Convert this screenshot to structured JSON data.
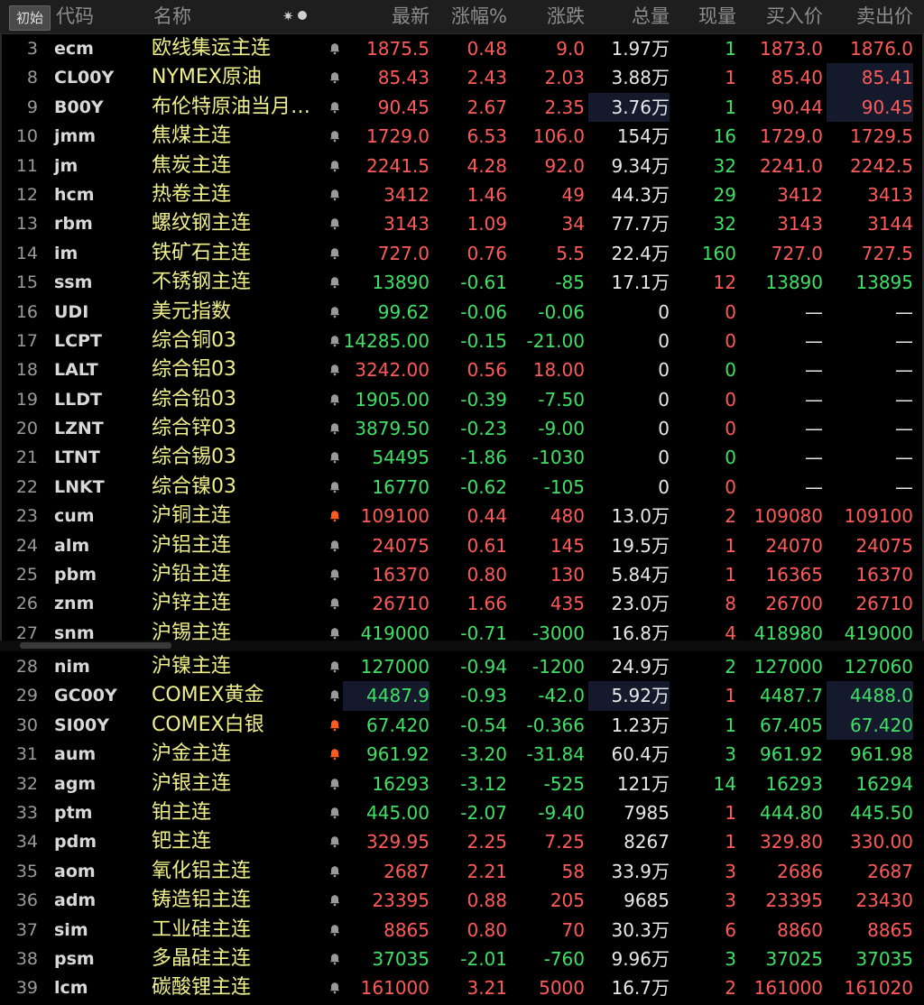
{
  "header": {
    "reset_button": "初始",
    "col_code": "代码",
    "col_name": "名称",
    "star_glyph": "✷",
    "col_last": "最新",
    "col_pct": "涨幅%",
    "col_chg": "涨跌",
    "col_vol": "总量",
    "col_cur": "现量",
    "col_bid": "买入价",
    "col_ask": "卖出价"
  },
  "colors": {
    "up": "#ff5a5a",
    "down": "#3ee066",
    "name": "#f0f08a",
    "bell_active": "#ff5a1e",
    "bell_inactive": "#9a9a9a"
  },
  "rows_top": [
    {
      "idx": "3",
      "code": "ecm",
      "name": "欧线集运主连",
      "bell": "inactive",
      "last": "1875.5",
      "pct": "0.48",
      "chg": "9.0",
      "vol": "1.97万",
      "cur": "1",
      "bid": "1873.0",
      "ask": "1876.0",
      "dir": "up",
      "cur_dir": "dn"
    },
    {
      "idx": "8",
      "code": "CL00Y",
      "name": "NYMEX原油",
      "bell": "inactive",
      "last": "85.43",
      "pct": "2.43",
      "chg": "2.03",
      "vol": "3.88万",
      "cur": "1",
      "bid": "85.40",
      "ask": "85.41",
      "dir": "up",
      "cur_dir": "up",
      "hl_ask": true
    },
    {
      "idx": "9",
      "code": "B00Y",
      "name": "布伦特原油当月…",
      "bell": "inactive",
      "last": "90.45",
      "pct": "2.67",
      "chg": "2.35",
      "vol": "3.76万",
      "cur": "1",
      "bid": "90.44",
      "ask": "90.45",
      "dir": "up",
      "cur_dir": "dn",
      "hl_vol": true,
      "hl_ask": true
    },
    {
      "idx": "10",
      "code": "jmm",
      "name": "焦煤主连",
      "bell": "inactive",
      "last": "1729.0",
      "pct": "6.53",
      "chg": "106.0",
      "vol": "154万",
      "cur": "16",
      "bid": "1729.0",
      "ask": "1729.5",
      "dir": "up",
      "cur_dir": "dn"
    },
    {
      "idx": "11",
      "code": "jm",
      "name": "焦炭主连",
      "bell": "inactive",
      "last": "2241.5",
      "pct": "4.28",
      "chg": "92.0",
      "vol": "9.34万",
      "cur": "32",
      "bid": "2241.0",
      "ask": "2242.5",
      "dir": "up",
      "cur_dir": "dn"
    },
    {
      "idx": "12",
      "code": "hcm",
      "name": "热卷主连",
      "bell": "inactive",
      "last": "3412",
      "pct": "1.46",
      "chg": "49",
      "vol": "44.3万",
      "cur": "29",
      "bid": "3412",
      "ask": "3413",
      "dir": "up",
      "cur_dir": "dn"
    },
    {
      "idx": "13",
      "code": "rbm",
      "name": "螺纹钢主连",
      "bell": "inactive",
      "last": "3143",
      "pct": "1.09",
      "chg": "34",
      "vol": "77.7万",
      "cur": "32",
      "bid": "3143",
      "ask": "3144",
      "dir": "up",
      "cur_dir": "dn"
    },
    {
      "idx": "14",
      "code": "im",
      "name": "铁矿石主连",
      "bell": "inactive",
      "last": "727.0",
      "pct": "0.76",
      "chg": "5.5",
      "vol": "22.4万",
      "cur": "160",
      "bid": "727.0",
      "ask": "727.5",
      "dir": "up",
      "cur_dir": "dn"
    },
    {
      "idx": "15",
      "code": "ssm",
      "name": "不锈钢主连",
      "bell": "inactive",
      "last": "13890",
      "pct": "-0.61",
      "chg": "-85",
      "vol": "17.1万",
      "cur": "12",
      "bid": "13890",
      "ask": "13895",
      "dir": "dn",
      "cur_dir": "up"
    },
    {
      "idx": "16",
      "code": "UDI",
      "name": "美元指数",
      "bell": "inactive",
      "last": "99.62",
      "pct": "-0.06",
      "chg": "-0.06",
      "vol": "0",
      "cur": "0",
      "bid": "—",
      "ask": "—",
      "dir": "dn",
      "cur_dir": "up"
    },
    {
      "idx": "17",
      "code": "LCPT",
      "name": "综合铜03",
      "bell": "inactive",
      "last": "14285.00",
      "pct": "-0.15",
      "chg": "-21.00",
      "vol": "0",
      "cur": "0",
      "bid": "—",
      "ask": "—",
      "dir": "dn",
      "cur_dir": "up"
    },
    {
      "idx": "18",
      "code": "LALT",
      "name": "综合铝03",
      "bell": "inactive",
      "last": "3242.00",
      "pct": "0.56",
      "chg": "18.00",
      "vol": "0",
      "cur": "0",
      "bid": "—",
      "ask": "—",
      "dir": "up",
      "cur_dir": "dn"
    },
    {
      "idx": "19",
      "code": "LLDT",
      "name": "综合铅03",
      "bell": "inactive",
      "last": "1905.00",
      "pct": "-0.39",
      "chg": "-7.50",
      "vol": "0",
      "cur": "0",
      "bid": "—",
      "ask": "—",
      "dir": "dn",
      "cur_dir": "up"
    },
    {
      "idx": "20",
      "code": "LZNT",
      "name": "综合锌03",
      "bell": "inactive",
      "last": "3879.50",
      "pct": "-0.23",
      "chg": "-9.00",
      "vol": "0",
      "cur": "0",
      "bid": "—",
      "ask": "—",
      "dir": "dn",
      "cur_dir": "up"
    },
    {
      "idx": "21",
      "code": "LTNT",
      "name": "综合锡03",
      "bell": "inactive",
      "last": "54495",
      "pct": "-1.86",
      "chg": "-1030",
      "vol": "0",
      "cur": "0",
      "bid": "—",
      "ask": "—",
      "dir": "dn",
      "cur_dir": "dn"
    },
    {
      "idx": "22",
      "code": "LNKT",
      "name": "综合镍03",
      "bell": "inactive",
      "last": "16770",
      "pct": "-0.62",
      "chg": "-105",
      "vol": "0",
      "cur": "0",
      "bid": "—",
      "ask": "—",
      "dir": "dn",
      "cur_dir": "up"
    },
    {
      "idx": "23",
      "code": "cum",
      "name": "沪铜主连",
      "bell": "active",
      "last": "109100",
      "pct": "0.44",
      "chg": "480",
      "vol": "13.0万",
      "cur": "2",
      "bid": "109080",
      "ask": "109100",
      "dir": "up",
      "cur_dir": "up"
    },
    {
      "idx": "24",
      "code": "alm",
      "name": "沪铝主连",
      "bell": "inactive",
      "last": "24075",
      "pct": "0.61",
      "chg": "145",
      "vol": "19.5万",
      "cur": "1",
      "bid": "24070",
      "ask": "24075",
      "dir": "up",
      "cur_dir": "up"
    },
    {
      "idx": "25",
      "code": "pbm",
      "name": "沪铅主连",
      "bell": "inactive",
      "last": "16370",
      "pct": "0.80",
      "chg": "130",
      "vol": "5.84万",
      "cur": "1",
      "bid": "16365",
      "ask": "16370",
      "dir": "up",
      "cur_dir": "up"
    },
    {
      "idx": "26",
      "code": "znm",
      "name": "沪锌主连",
      "bell": "inactive",
      "last": "26710",
      "pct": "1.66",
      "chg": "435",
      "vol": "23.0万",
      "cur": "8",
      "bid": "26700",
      "ask": "26710",
      "dir": "up",
      "cur_dir": "up"
    },
    {
      "idx": "27",
      "code": "snm",
      "name": "沪锡主连",
      "bell": "inactive",
      "last": "419000",
      "pct": "-0.71",
      "chg": "-3000",
      "vol": "16.8万",
      "cur": "4",
      "bid": "418980",
      "ask": "419000",
      "dir": "dn",
      "cur_dir": "up"
    }
  ],
  "rows_bottom": [
    {
      "idx": "28",
      "code": "nim",
      "name": "沪镍主连",
      "bell": "inactive",
      "last": "127000",
      "pct": "-0.94",
      "chg": "-1200",
      "vol": "24.9万",
      "cur": "2",
      "bid": "127000",
      "ask": "127060",
      "dir": "dn",
      "cur_dir": "dn"
    },
    {
      "idx": "29",
      "code": "GC00Y",
      "name": "COMEX黄金",
      "bell": "inactive",
      "last": "4487.9",
      "pct": "-0.93",
      "chg": "-42.0",
      "vol": "5.92万",
      "cur": "1",
      "bid": "4487.7",
      "ask": "4488.0",
      "dir": "dn",
      "cur_dir": "up",
      "hl_last": true,
      "hl_vol": true,
      "hl_ask": true
    },
    {
      "idx": "30",
      "code": "SI00Y",
      "name": "COMEX白银",
      "bell": "active",
      "last": "67.420",
      "pct": "-0.54",
      "chg": "-0.366",
      "vol": "1.23万",
      "cur": "1",
      "bid": "67.405",
      "ask": "67.420",
      "dir": "dn",
      "cur_dir": "dn",
      "hl_ask": true
    },
    {
      "idx": "31",
      "code": "aum",
      "name": "沪金主连",
      "bell": "active",
      "last": "961.92",
      "pct": "-3.20",
      "chg": "-31.84",
      "vol": "60.4万",
      "cur": "3",
      "bid": "961.92",
      "ask": "961.98",
      "dir": "dn",
      "cur_dir": "dn"
    },
    {
      "idx": "32",
      "code": "agm",
      "name": "沪银主连",
      "bell": "inactive",
      "last": "16293",
      "pct": "-3.12",
      "chg": "-525",
      "vol": "121万",
      "cur": "14",
      "bid": "16293",
      "ask": "16294",
      "dir": "dn",
      "cur_dir": "dn"
    },
    {
      "idx": "33",
      "code": "ptm",
      "name": "铂主连",
      "bell": "inactive",
      "last": "445.00",
      "pct": "-2.07",
      "chg": "-9.40",
      "vol": "7985",
      "cur": "1",
      "bid": "444.80",
      "ask": "445.50",
      "dir": "dn",
      "cur_dir": "up"
    },
    {
      "idx": "34",
      "code": "pdm",
      "name": "钯主连",
      "bell": "inactive",
      "last": "329.95",
      "pct": "2.25",
      "chg": "7.25",
      "vol": "8267",
      "cur": "1",
      "bid": "329.80",
      "ask": "330.00",
      "dir": "up",
      "cur_dir": "up"
    },
    {
      "idx": "35",
      "code": "aom",
      "name": "氧化铝主连",
      "bell": "inactive",
      "last": "2687",
      "pct": "2.21",
      "chg": "58",
      "vol": "33.9万",
      "cur": "3",
      "bid": "2686",
      "ask": "2687",
      "dir": "up",
      "cur_dir": "up"
    },
    {
      "idx": "36",
      "code": "adm",
      "name": "铸造铝主连",
      "bell": "inactive",
      "last": "23395",
      "pct": "0.88",
      "chg": "205",
      "vol": "9685",
      "cur": "3",
      "bid": "23395",
      "ask": "23430",
      "dir": "up",
      "cur_dir": "up"
    },
    {
      "idx": "37",
      "code": "sim",
      "name": "工业硅主连",
      "bell": "inactive",
      "last": "8865",
      "pct": "0.80",
      "chg": "70",
      "vol": "30.3万",
      "cur": "6",
      "bid": "8860",
      "ask": "8865",
      "dir": "up",
      "cur_dir": "up"
    },
    {
      "idx": "38",
      "code": "psm",
      "name": "多晶硅主连",
      "bell": "inactive",
      "last": "37035",
      "pct": "-2.01",
      "chg": "-760",
      "vol": "9.96万",
      "cur": "3",
      "bid": "37025",
      "ask": "37035",
      "dir": "dn",
      "cur_dir": "dn"
    },
    {
      "idx": "39",
      "code": "lcm",
      "name": "碳酸锂主连",
      "bell": "inactive",
      "last": "161000",
      "pct": "3.21",
      "chg": "5000",
      "vol": "16.7万",
      "cur": "2",
      "bid": "161000",
      "ask": "161020",
      "dir": "up",
      "cur_dir": "up"
    }
  ]
}
